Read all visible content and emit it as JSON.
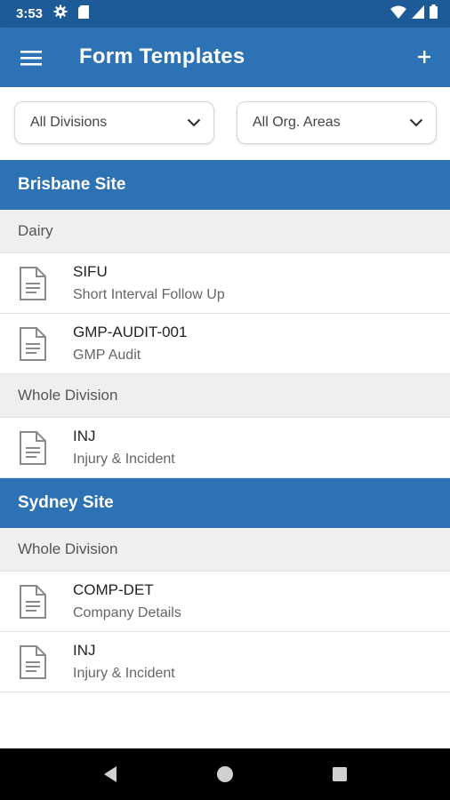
{
  "status_bar": {
    "time": "3:53",
    "left_icons": [
      "gear-icon",
      "sd-card-icon"
    ],
    "right_icons": [
      "wifi-icon",
      "signal-icon",
      "battery-icon"
    ]
  },
  "app_bar": {
    "title": "Form Templates",
    "menu_icon": "hamburger-menu-icon",
    "add_icon": "plus-icon",
    "color": "#2d72b5"
  },
  "filters": {
    "division": {
      "selected": "All Divisions",
      "icon": "chevron-down-icon"
    },
    "org_area": {
      "selected": "All Org. Areas",
      "icon": "chevron-down-icon"
    }
  },
  "sites": [
    {
      "name": "Brisbane Site",
      "areas": [
        {
          "name": "Dairy",
          "forms": [
            {
              "code": "SIFU",
              "name": "Short Interval Follow Up"
            },
            {
              "code": "GMP-AUDIT-001",
              "name": "GMP Audit"
            }
          ]
        },
        {
          "name": "Whole Division",
          "forms": [
            {
              "code": "INJ",
              "name": "Injury & Incident"
            }
          ]
        }
      ]
    },
    {
      "name": "Sydney Site",
      "areas": [
        {
          "name": "Whole Division",
          "forms": [
            {
              "code": "COMP-DET",
              "name": "Company Details"
            },
            {
              "code": "INJ",
              "name": "Injury & Incident"
            }
          ]
        }
      ]
    }
  ],
  "nav_bar": {
    "icons": [
      "back-icon",
      "home-icon",
      "recents-icon"
    ]
  }
}
